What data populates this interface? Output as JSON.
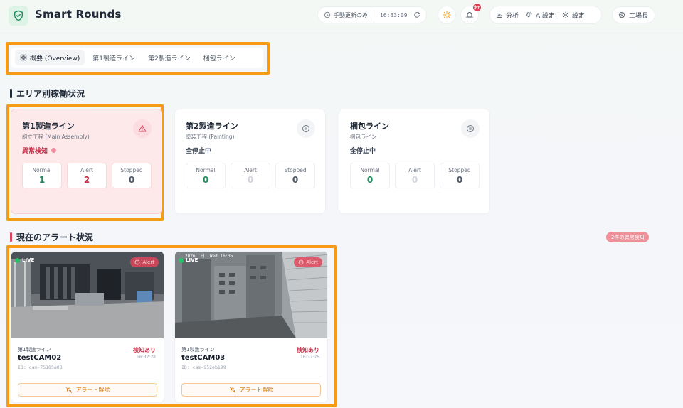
{
  "header": {
    "app_title": "Smart Rounds",
    "update_mode": "手動更新のみ",
    "clock": "16:33:09",
    "notification_count": "9+",
    "nav": [
      {
        "label": "分析",
        "icon": "bar-chart-icon"
      },
      {
        "label": "AI設定",
        "icon": "brain-icon"
      },
      {
        "label": "設定",
        "icon": "gear-icon"
      }
    ],
    "user": "工場長"
  },
  "tabs": [
    {
      "label": "概要 (Overview)",
      "active": true
    },
    {
      "label": "第1製造ライン",
      "active": false
    },
    {
      "label": "第2製造ライン",
      "active": false
    },
    {
      "label": "梱包ライン",
      "active": false
    }
  ],
  "area_section": {
    "title": "エリア別稼働状況",
    "stat_labels": {
      "normal": "Normal",
      "alert": "Alert",
      "stopped": "Stopped"
    },
    "areas": [
      {
        "name": "第1製造ライン",
        "sub": "組立工程 (Main Assembly)",
        "status": "異常検知",
        "status_type": "alert",
        "icon": "warning-triangle-icon",
        "normal": "1",
        "alert": "2",
        "stopped": "0"
      },
      {
        "name": "第2製造ライン",
        "sub": "塗装工程 (Painting)",
        "status": "全停止中",
        "status_type": "stopped",
        "icon": "pause-circle-icon",
        "normal": "0",
        "alert": "0",
        "stopped": "0"
      },
      {
        "name": "梱包ライン",
        "sub": "梱包ライン",
        "status": "全停止中",
        "status_type": "stopped",
        "icon": "pause-circle-icon",
        "normal": "0",
        "alert": "0",
        "stopped": "0"
      }
    ]
  },
  "alert_section": {
    "title": "現在のアラート状況",
    "count_badge": "2件の異常検知",
    "cameras": [
      {
        "live": "LIVE",
        "alert_chip": "Alert",
        "line": "第1製造ライン",
        "name": "testCAM02",
        "id": "ID: cam-75185a08",
        "detect": "検知あり",
        "time": "16:32:28",
        "button": "アラート解除"
      },
      {
        "live": "LIVE",
        "overlay_time": "2026. 日, Wed 16:35",
        "alert_chip": "Alert",
        "line": "第1製造ライン",
        "name": "testCAM03",
        "id": "ID: cam-952eb199",
        "detect": "検知あり",
        "time": "16:32:26",
        "button": "アラート解除"
      }
    ]
  },
  "colors": {
    "brand_green": "#1f8a5b",
    "alert_red": "#c2324a",
    "highlight_orange": "#f59b16",
    "alert_card_bg": "#fde8ea"
  }
}
